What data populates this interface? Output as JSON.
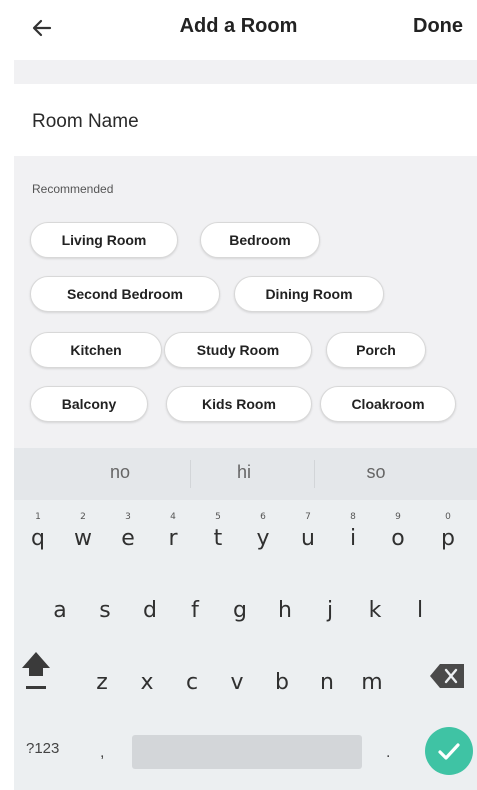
{
  "header": {
    "back_icon": "arrow-left-icon",
    "title": "Add a Room",
    "done_label": "Done"
  },
  "form": {
    "room_name_placeholder": "Room Name",
    "room_name_value": ""
  },
  "recommended": {
    "label": "Recommended",
    "chips": [
      "Living Room",
      "Bedroom",
      "Second Bedroom",
      "Dining Room",
      "Kitchen",
      "Study Room",
      "Porch",
      "Balcony",
      "Kids Room",
      "Cloakroom"
    ]
  },
  "keyboard": {
    "suggestions": [
      "no",
      "hi",
      "so"
    ],
    "row1": [
      "q",
      "w",
      "e",
      "r",
      "t",
      "y",
      "u",
      "i",
      "o",
      "p"
    ],
    "row1_hints": [
      "1",
      "2",
      "3",
      "4",
      "5",
      "6",
      "7",
      "8",
      "9",
      "0"
    ],
    "row2": [
      "a",
      "s",
      "d",
      "f",
      "g",
      "h",
      "j",
      "k",
      "l"
    ],
    "row3": [
      "z",
      "x",
      "c",
      "v",
      "b",
      "n",
      "m"
    ],
    "symbols_label": "?123",
    "comma": ",",
    "period": ".",
    "accent_color": "#3fc3a4"
  }
}
